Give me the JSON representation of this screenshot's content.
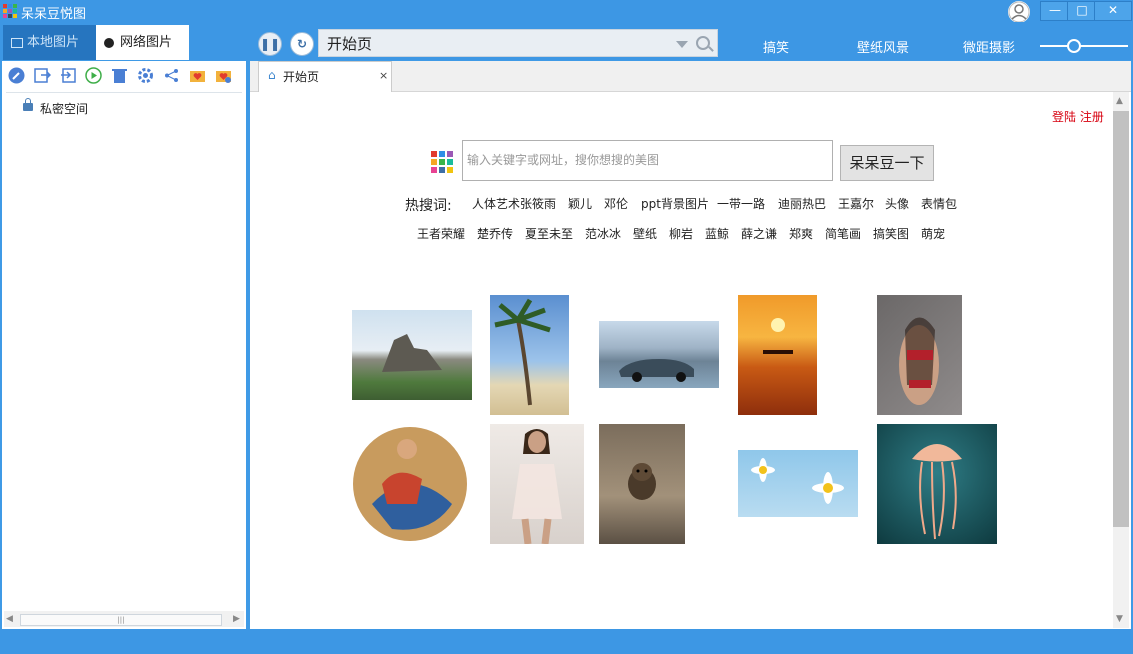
{
  "window": {
    "title": "呆呆豆悦图",
    "minimize": "—",
    "maximize": "□",
    "close": "✕"
  },
  "top_tabs": {
    "local": "本地图片",
    "network": "网络图片"
  },
  "address_bar": {
    "value": "开始页"
  },
  "nav_links": [
    "搞笑",
    "壁纸风景",
    "微距摄影"
  ],
  "left_panel": {
    "tools": [
      "edit-icon",
      "export-icon",
      "import-icon",
      "play-icon",
      "delete-icon",
      "settings-icon",
      "share-icon",
      "favorite-folder-icon",
      "favorite-folder2-icon"
    ],
    "tree_items": [
      {
        "label": "私密空间",
        "icon": "lock-icon"
      }
    ],
    "scroll_grip": "|||"
  },
  "browser_tab": {
    "label": "开始页",
    "close": "×"
  },
  "start_page": {
    "login": "登陆 注册",
    "search_placeholder": "输入关键字或网址，搜你想搜的美图",
    "search_button": "呆呆豆一下",
    "hot_label": "热搜词:",
    "hot_row1": [
      "人体艺术张筱雨",
      "颖儿",
      "邓伦",
      "ppt背景图片",
      "一带一路",
      "迪丽热巴",
      "王嘉尔",
      "头像",
      "表情包"
    ],
    "hot_row2": [
      "王者荣耀",
      "楚乔传",
      "夏至未至",
      "范冰冰",
      "壁纸",
      "柳岩",
      "蓝鲸",
      "薛之谦",
      "郑爽",
      "简笔画",
      "搞笑图",
      "萌宠"
    ]
  },
  "colors": {
    "accent": "#3d97e4",
    "login_red": "#d7000f"
  }
}
